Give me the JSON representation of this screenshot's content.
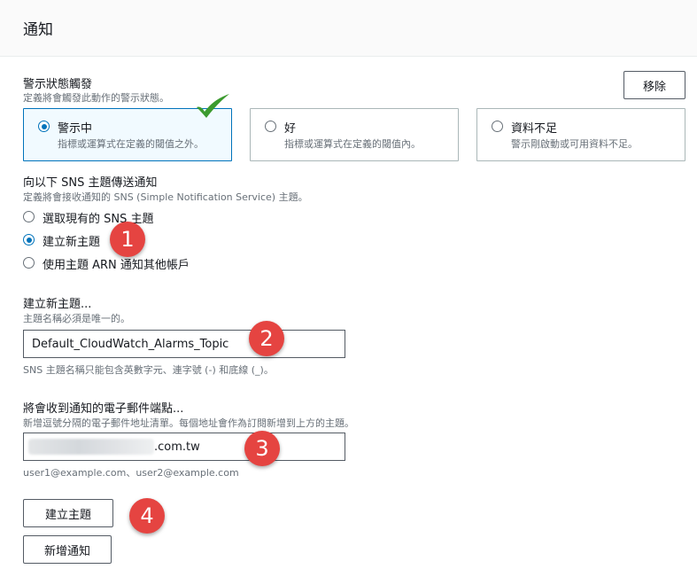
{
  "header": {
    "title": "通知"
  },
  "alarm_state": {
    "label": "警示狀態觸發",
    "description": "定義將會觸發此動作的警示狀態。",
    "remove_label": "移除",
    "options": [
      {
        "title": "警示中",
        "description": "指標或運算式在定義的閾值之外。",
        "selected": true
      },
      {
        "title": "好",
        "description": "指標或運算式在定義的閾值內。",
        "selected": false
      },
      {
        "title": "資料不足",
        "description": "警示剛啟動或可用資料不足。",
        "selected": false
      }
    ]
  },
  "sns": {
    "label": "向以下 SNS 主題傳送通知",
    "description": "定義將會接收通知的 SNS (Simple Notification Service) 主題。",
    "options": [
      {
        "label": "選取現有的 SNS 主題",
        "selected": false
      },
      {
        "label": "建立新主題",
        "selected": true
      },
      {
        "label": "使用主題 ARN 通知其他帳戶",
        "selected": false
      }
    ]
  },
  "new_topic": {
    "label": "建立新主題...",
    "description": "主題名稱必須是唯一的。",
    "value": "Default_CloudWatch_Alarms_Topic",
    "hint": "SNS 主題名稱只能包含英數字元、連字號 (-) 和底線 (_)。"
  },
  "email": {
    "label": "將會收到通知的電子郵件端點...",
    "description": "新增逗號分隔的電子郵件地址清單。每個地址會作為訂閱新增到上方的主題。",
    "value_visible": ".com.tw",
    "hint": "user1@example.com、user2@example.com"
  },
  "buttons": {
    "create_topic": "建立主題",
    "add_notification": "新增通知"
  },
  "annotations": {
    "step1": "1",
    "step2": "2",
    "step3": "3",
    "step4": "4"
  },
  "colors": {
    "selected_border": "#0073bb",
    "selected_background": "#f1faff",
    "badge": "#e54441",
    "checkmark": "#3c9b2f"
  }
}
